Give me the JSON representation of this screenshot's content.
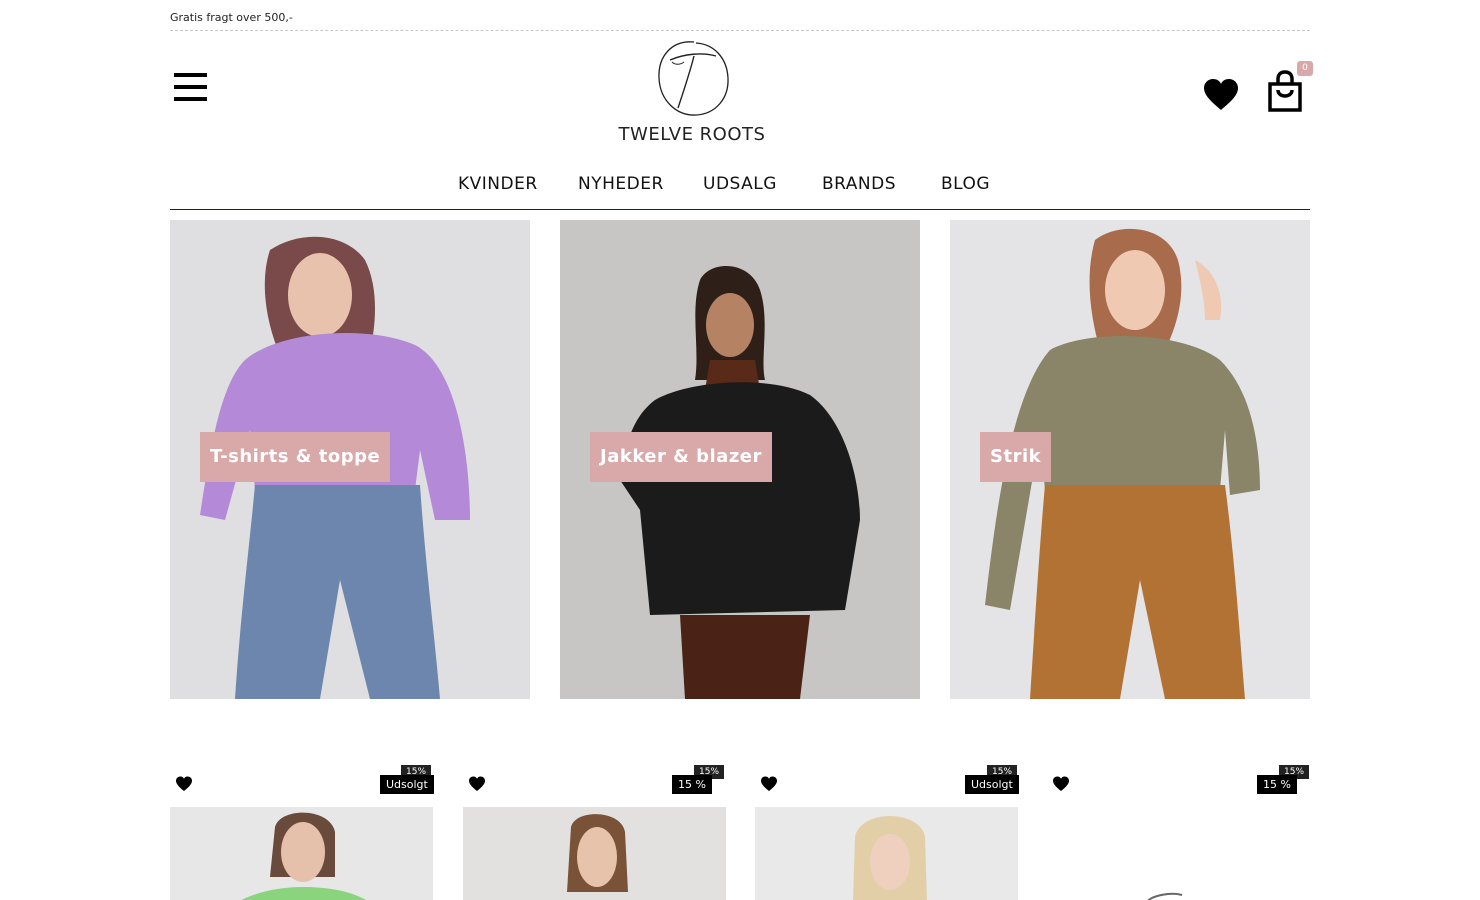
{
  "announcement": "Gratis fragt over 500,-",
  "brand": {
    "name": "TWELVE ROOTS",
    "accent": "#d9a9aa"
  },
  "header": {
    "menu_icon": "hamburger-menu-icon",
    "wishlist_icon": "heart-icon",
    "cart_icon": "shopping-bag-icon",
    "cart_count": "0"
  },
  "nav": {
    "items": [
      {
        "label": "KVINDER"
      },
      {
        "label": "NYHEDER"
      },
      {
        "label": "UDSALG"
      },
      {
        "label": "BRANDS"
      },
      {
        "label": "BLOG"
      }
    ]
  },
  "categories": [
    {
      "label": "T-shirts & toppe",
      "image": "woman in lilac ribbed top and blue jeans"
    },
    {
      "label": "Jakker & blazer",
      "image": "woman in black blazer over brown knit dress"
    },
    {
      "label": "Strik",
      "image": "woman in olive knit sweater and camel trousers"
    }
  ],
  "products": [
    {
      "discount": "15%",
      "badge": "Udsolgt"
    },
    {
      "discount": "15%",
      "badge": "15 %"
    },
    {
      "discount": "15%",
      "badge": "Udsolgt"
    },
    {
      "discount": "15%",
      "badge": "15 %"
    }
  ]
}
